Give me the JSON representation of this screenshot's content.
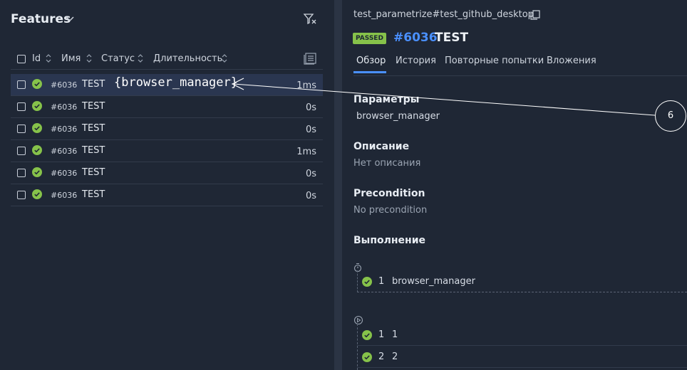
{
  "sidebar": {
    "title": "Features",
    "columns": {
      "id": "Id",
      "name": "Имя",
      "status": "Статус",
      "duration": "Длительность"
    },
    "rows": [
      {
        "id": "#6036",
        "name": "TEST",
        "duration": "1ms",
        "selected": true
      },
      {
        "id": "#6036",
        "name": "TEST",
        "duration": "0s"
      },
      {
        "id": "#6036",
        "name": "TEST",
        "duration": "0s"
      },
      {
        "id": "#6036",
        "name": "TEST",
        "duration": "1ms"
      },
      {
        "id": "#6036",
        "name": "TEST",
        "duration": "0s"
      },
      {
        "id": "#6036",
        "name": "TEST",
        "duration": "0s"
      }
    ],
    "annotation": "{browser_manager}"
  },
  "detail": {
    "path": "test_parametrize#test_github_desktop",
    "status_badge": "PASSED",
    "id": "#6036",
    "name": "TEST",
    "tabs": [
      "Обзор",
      "История",
      "Повторные попытки",
      "Вложения"
    ],
    "parameters_title": "Параметры",
    "parameters_value": "browser_manager",
    "description_title": "Описание",
    "description_value": "Нет описания",
    "precondition_title": "Precondition",
    "precondition_value": "No precondition",
    "execution_title": "Выполнение",
    "setup_step": {
      "num": "1",
      "name": "browser_manager"
    },
    "body_steps": [
      {
        "num": "1",
        "name": "1"
      },
      {
        "num": "2",
        "name": "2"
      }
    ]
  },
  "callout": "6",
  "colors": {
    "accent": "#4a90ff",
    "passed": "#86c24a",
    "bg": "#1f2735"
  }
}
